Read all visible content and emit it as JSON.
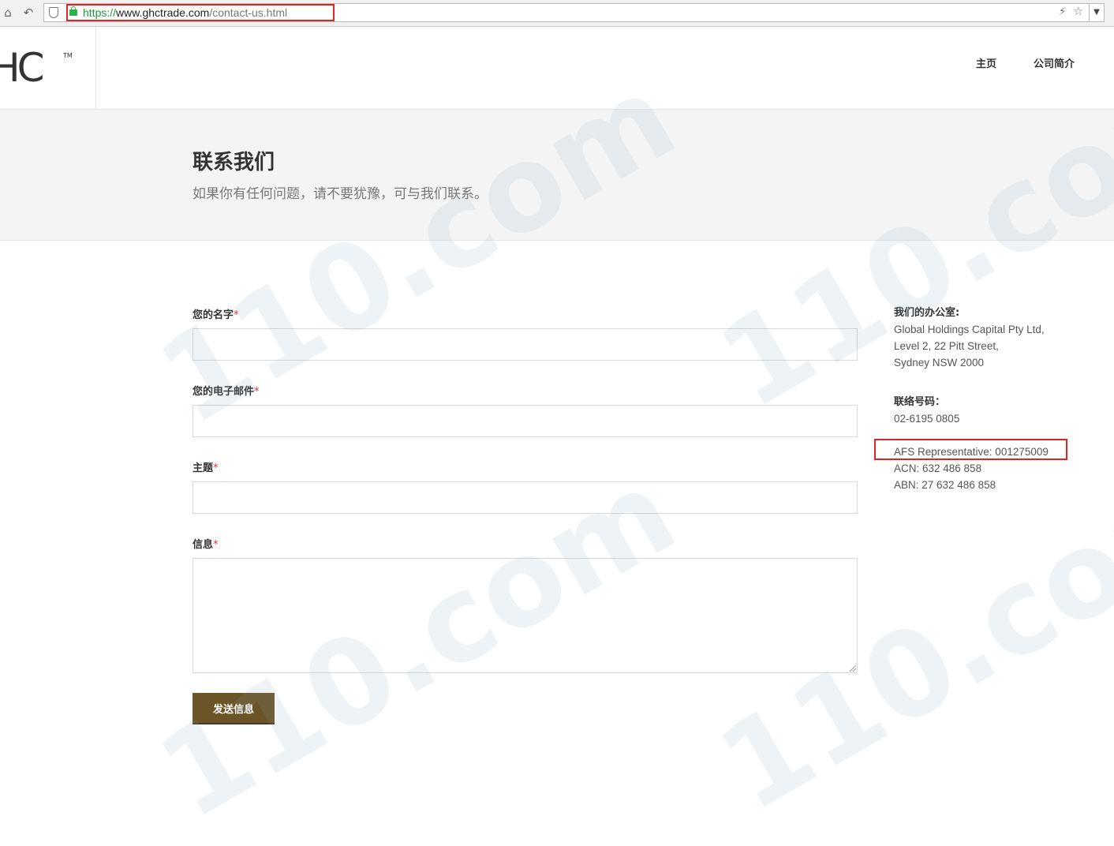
{
  "browser": {
    "url_scheme": "https://",
    "url_host": "www.ghctrade.com",
    "url_path": "/contact-us.html"
  },
  "header": {
    "logo_text": "HC",
    "logo_tm": "TM",
    "nav": [
      "主页",
      "公司简介"
    ]
  },
  "hero": {
    "title": "联系我们",
    "subtitle": "如果你有任何问题，请不要犹豫，可与我们联系。"
  },
  "form": {
    "name_label": "您的名字",
    "email_label": "您的电子邮件",
    "subject_label": "主题",
    "message_label": "信息",
    "required_mark": "*",
    "submit_label": "发送信息"
  },
  "office": {
    "heading": "我们的办公室:",
    "address": [
      "Global Holdings Capital Pty Ltd,",
      "Level 2, 22 Pitt Street,",
      "Sydney NSW 2000"
    ],
    "phone_heading": "联络号码：",
    "phone": "02-6195 0805",
    "afs": "AFS Representative: 001275009",
    "acn": "ACN: 632 486 858",
    "abn": "ABN: 27 632 486 858"
  },
  "watermark": "110.com",
  "colors": {
    "submit_bg": "#6b5428",
    "highlight": "#e02424",
    "hero_bg": "#f4f4f4"
  }
}
